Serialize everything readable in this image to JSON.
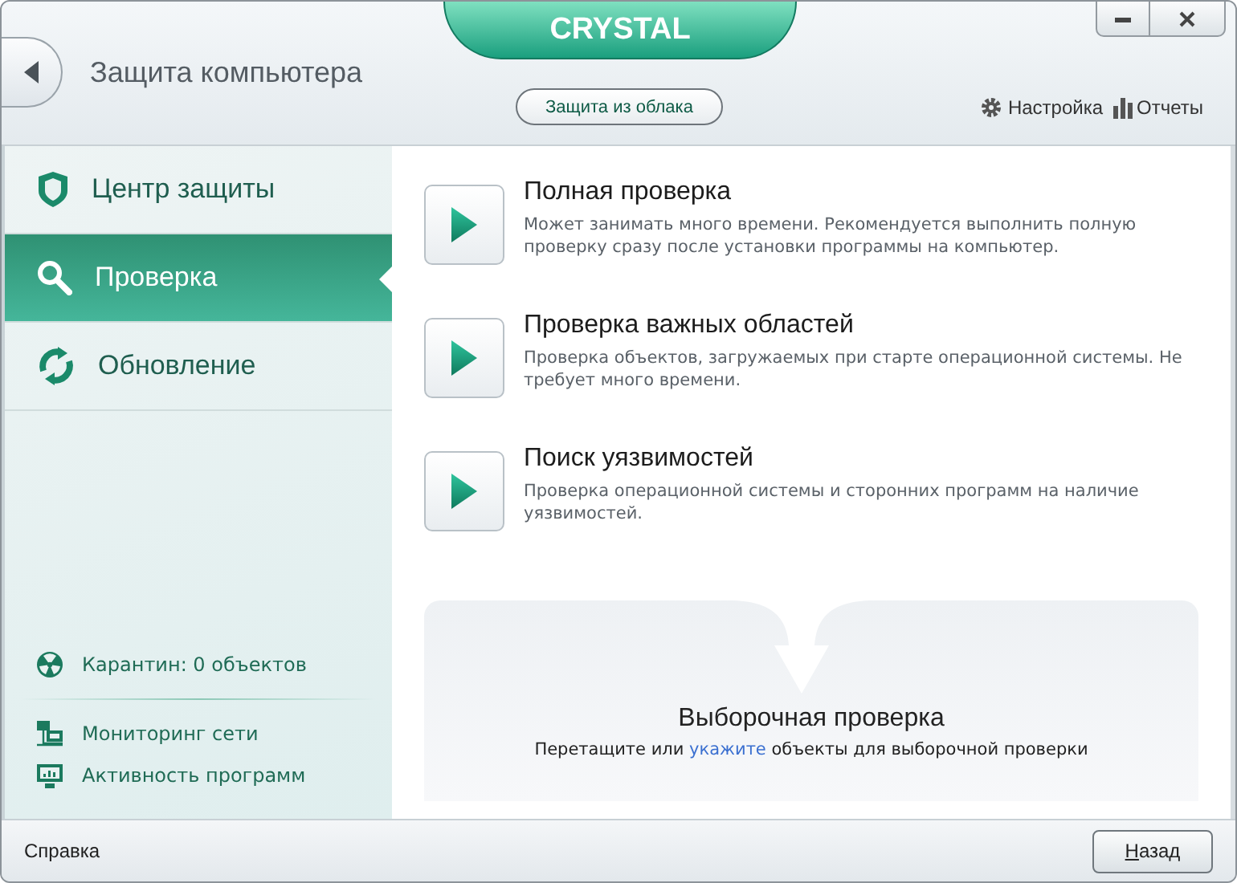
{
  "window": {
    "logo": "CRYSTAL",
    "title": "Защита компьютера"
  },
  "header": {
    "cloud_button": "Защита из облака",
    "links": [
      "Настройка",
      "Отчеты"
    ]
  },
  "sidebar": {
    "items": [
      {
        "label": "Центр защиты",
        "selected": false
      },
      {
        "label": "Проверка",
        "selected": true
      },
      {
        "label": "Обновление",
        "selected": false
      }
    ],
    "quarantine": "Карантин: 0 объектов",
    "tools": [
      "Мониторинг сети",
      "Активность программ"
    ]
  },
  "scans": [
    {
      "title": "Полная проверка",
      "description": "Может занимать много времени. Рекомендуется выполнить полную проверку сразу после установки программы на компьютер."
    },
    {
      "title": "Проверка важных областей",
      "description": "Проверка объектов, загружаемых при старте операционной системы. Не требует много времени."
    },
    {
      "title": "Поиск уязвимостей",
      "description": "Проверка операционной системы и сторонних программ на наличие уязвимостей."
    }
  ],
  "custom_scan": {
    "title": "Выборочная проверка",
    "hint_before": "Перетащите или",
    "hint_link": "укажите",
    "hint_after": "объекты для выборочной проверки"
  },
  "footer": {
    "help": "Справка",
    "back_button": "Назад"
  }
}
